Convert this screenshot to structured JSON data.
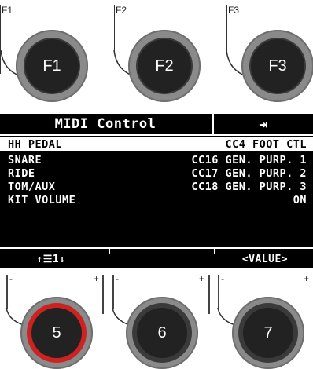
{
  "function_buttons": [
    {
      "label": "F1",
      "caption": "F1"
    },
    {
      "label": "F2",
      "caption": "F2"
    },
    {
      "label": "F3",
      "caption": "F3"
    }
  ],
  "screen": {
    "title": "MIDI Control",
    "exit_icon_glyph": "⇥",
    "rows": [
      {
        "key": "HH PEDAL",
        "value": "CC4 FOOT CTL",
        "selected": true
      },
      {
        "key": "SNARE",
        "value": "CC16 GEN. PURP. 1",
        "selected": false
      },
      {
        "key": "RIDE",
        "value": "CC17 GEN. PURP. 2",
        "selected": false
      },
      {
        "key": "TOM/AUX",
        "value": "CC18 GEN. PURP. 3",
        "selected": false
      },
      {
        "key": "KIT VOLUME",
        "value": "ON",
        "selected": false
      }
    ],
    "softkeys": {
      "left": "↑☰1↓",
      "right": "<VALUE>"
    }
  },
  "encoders": [
    {
      "label": "5",
      "minus": "-",
      "plus": "+",
      "active": true
    },
    {
      "label": "6",
      "minus": "-",
      "plus": "+",
      "active": false
    },
    {
      "label": "7",
      "minus": "-",
      "plus": "+",
      "active": false
    }
  ],
  "colors": {
    "screen_bg": "#000000",
    "screen_fg": "#ffffff",
    "active_ring": "#cc2222",
    "knob_dark": "#222222",
    "knob_ring": "#8a8a8a"
  }
}
